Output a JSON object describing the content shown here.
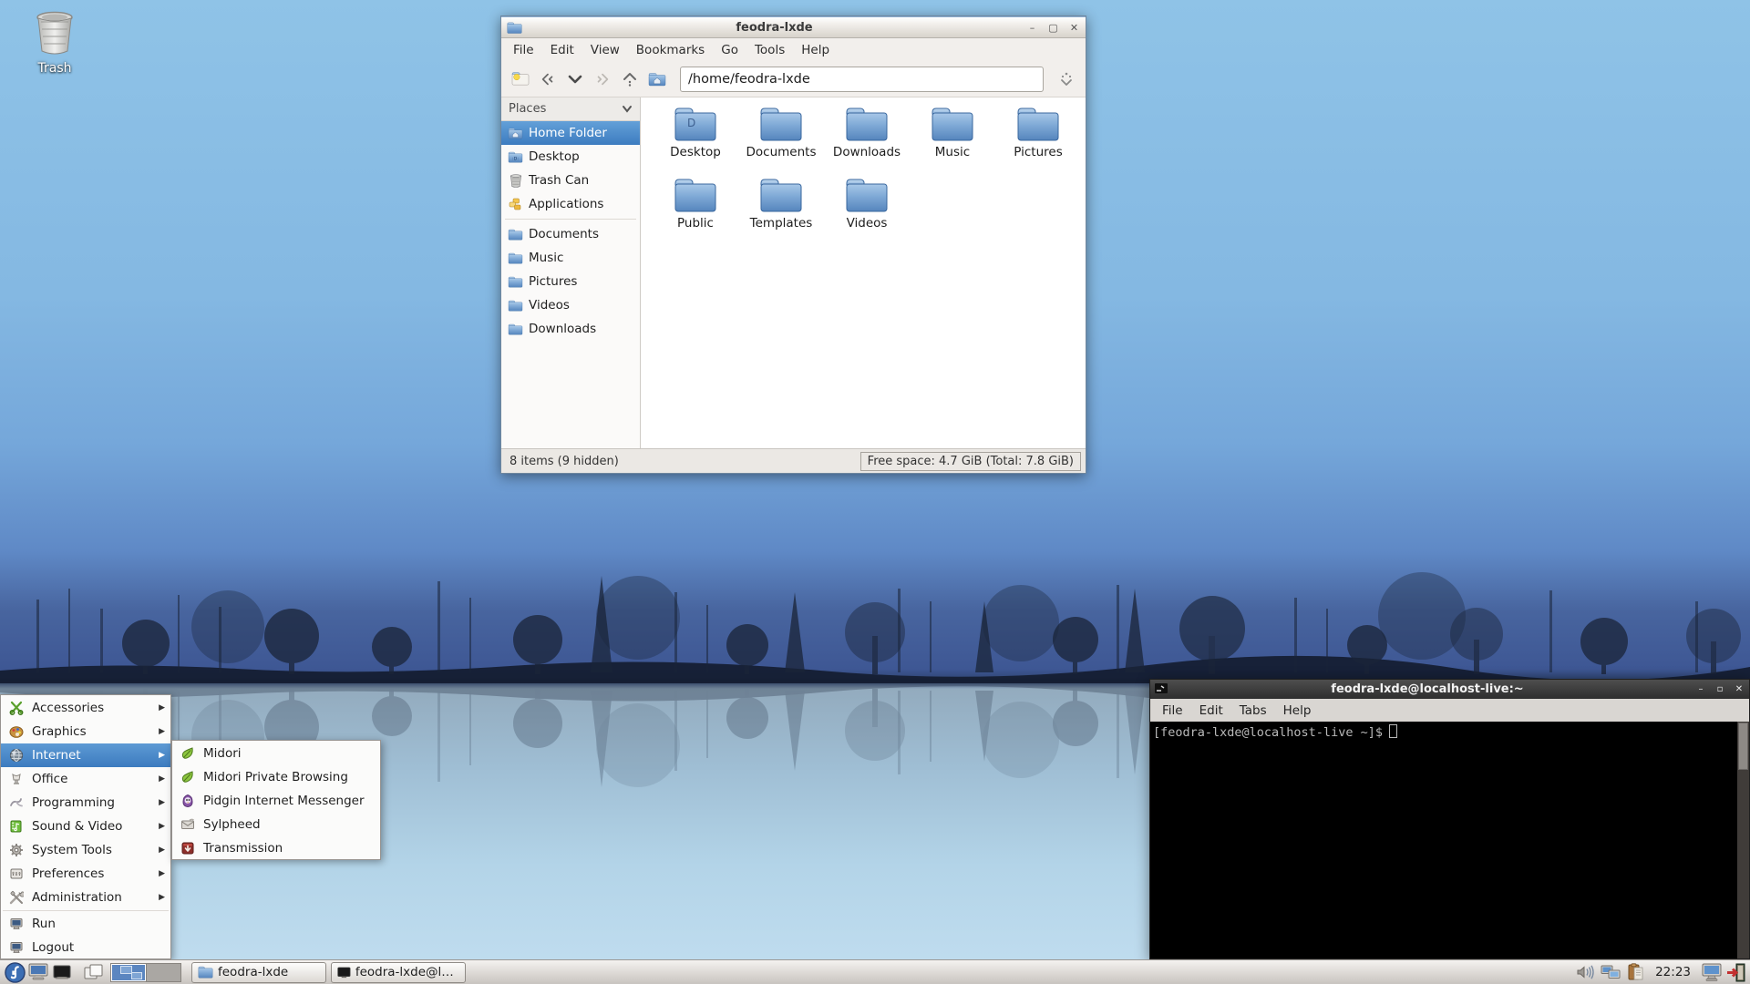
{
  "desktop": {
    "trash_label": "Trash"
  },
  "file_manager": {
    "title": "feodra-lxde",
    "window_controls": {
      "minimize": "–",
      "maximize": "▢",
      "close": "✕"
    },
    "menu": [
      "File",
      "Edit",
      "View",
      "Bookmarks",
      "Go",
      "Tools",
      "Help"
    ],
    "toolbar_icons": [
      "new-tab-icon",
      "back-icon",
      "history-dropdown-icon",
      "forward-icon",
      "up-icon",
      "home-icon",
      "jump-icon"
    ],
    "path": "/home/feodra-lxde",
    "places": {
      "header": "Places",
      "items": [
        {
          "label": "Home Folder",
          "icon": "home-folder-icon",
          "selected": true
        },
        {
          "label": "Desktop",
          "icon": "desktop-folder-icon",
          "selected": false
        },
        {
          "label": "Trash Can",
          "icon": "trash-can-icon",
          "selected": false
        },
        {
          "label": "Applications",
          "icon": "applications-icon",
          "selected": false
        },
        {
          "label": "Documents",
          "icon": "folder-icon",
          "selected": false
        },
        {
          "label": "Music",
          "icon": "folder-icon",
          "selected": false
        },
        {
          "label": "Pictures",
          "icon": "folder-icon",
          "selected": false
        },
        {
          "label": "Videos",
          "icon": "folder-icon",
          "selected": false
        },
        {
          "label": "Downloads",
          "icon": "folder-icon",
          "selected": false
        }
      ]
    },
    "folders": [
      {
        "label": "Desktop",
        "emblem": "D"
      },
      {
        "label": "Documents",
        "emblem": ""
      },
      {
        "label": "Downloads",
        "emblem": ""
      },
      {
        "label": "Music",
        "emblem": ""
      },
      {
        "label": "Pictures",
        "emblem": ""
      },
      {
        "label": "Public",
        "emblem": ""
      },
      {
        "label": "Templates",
        "emblem": ""
      },
      {
        "label": "Videos",
        "emblem": ""
      }
    ],
    "status_left": "8 items (9 hidden)",
    "status_right": "Free space: 4.7 GiB (Total: 7.8 GiB)"
  },
  "terminal": {
    "title": "feodra-lxde@localhost-live:~",
    "window_controls": {
      "minimize": "–",
      "maximize": "▫",
      "close": "✕"
    },
    "menu": [
      "File",
      "Edit",
      "Tabs",
      "Help"
    ],
    "prompt": "[feodra-lxde@localhost-live ~]$"
  },
  "start_menu": {
    "items": [
      {
        "label": "Accessories",
        "icon": "accessories-icon",
        "has_submenu": true
      },
      {
        "label": "Graphics",
        "icon": "graphics-icon",
        "has_submenu": true
      },
      {
        "label": "Internet",
        "icon": "internet-globe-icon",
        "has_submenu": true,
        "selected": true
      },
      {
        "label": "Office",
        "icon": "office-icon",
        "has_submenu": true
      },
      {
        "label": "Programming",
        "icon": "programming-icon",
        "has_submenu": true
      },
      {
        "label": "Sound & Video",
        "icon": "sound-video-icon",
        "has_submenu": true
      },
      {
        "label": "System Tools",
        "icon": "system-tools-gear-icon",
        "has_submenu": true
      },
      {
        "label": "Preferences",
        "icon": "preferences-icon",
        "has_submenu": true
      },
      {
        "label": "Administration",
        "icon": "administration-tools-icon",
        "has_submenu": true
      },
      {
        "label": "Run",
        "icon": "run-monitor-icon",
        "has_submenu": false
      },
      {
        "label": "Logout",
        "icon": "logout-monitor-icon",
        "has_submenu": false
      }
    ],
    "submenu_arrow": "▶",
    "internet_submenu": [
      {
        "label": "Midori",
        "icon": "midori-leaf-icon"
      },
      {
        "label": "Midori Private Browsing",
        "icon": "midori-leaf-icon"
      },
      {
        "label": "Pidgin Internet Messenger",
        "icon": "pidgin-icon"
      },
      {
        "label": "Sylpheed",
        "icon": "sylpheed-mail-icon"
      },
      {
        "label": "Transmission",
        "icon": "transmission-icon"
      }
    ]
  },
  "taskbar": {
    "start_letter": "f",
    "tasks": [
      {
        "label": "feodra-lxde",
        "icon": "folder-icon"
      },
      {
        "label": "feodra-lxde@loc...",
        "icon": "terminal-icon"
      }
    ],
    "tray_icons": [
      "volume-icon",
      "network-icon",
      "clipboard-icon",
      "lock-screen-icon",
      "logout-door-icon"
    ],
    "clock": "22:23"
  },
  "colors": {
    "selection_blue": "#3d7cc0",
    "folder_blue": "#6da1d8",
    "terminal_bg": "#000000",
    "terminal_fg": "#b9b9b9",
    "taskbar_bg": "#d6d2ce",
    "wallpaper_sky": "#8fc3e7",
    "wallpaper_deep": "#3e5794",
    "wallpaper_mist": "#c2def0"
  }
}
